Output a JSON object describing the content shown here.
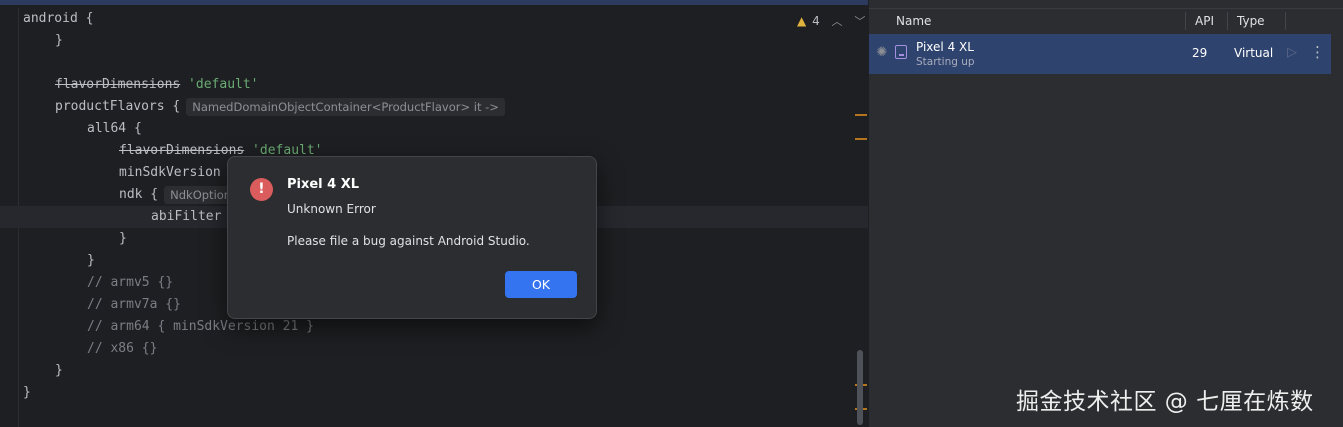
{
  "editor": {
    "lines": [
      {
        "indent": 0,
        "segments": [
          {
            "text": "android {",
            "cls": "kw"
          }
        ]
      },
      {
        "indent": 1,
        "segments": [
          {
            "text": "}",
            "cls": "kw"
          }
        ]
      },
      {
        "indent": 0,
        "segments": []
      },
      {
        "indent": 1,
        "segments": [
          {
            "text": "flavorDimensions",
            "cls": "kw strike"
          },
          {
            "text": " 'default'",
            "cls": "str"
          }
        ]
      },
      {
        "indent": 1,
        "segments": [
          {
            "text": "productFlavors {",
            "cls": "kw"
          }
        ],
        "hint": "NamedDomainObjectContainer<ProductFlavor> it ->"
      },
      {
        "indent": 2,
        "segments": [
          {
            "text": "all64",
            "cls": "fnname"
          },
          {
            "text": " {",
            "cls": "kw"
          }
        ]
      },
      {
        "indent": 3,
        "segments": [
          {
            "text": "flavorDimensions",
            "cls": "kw strike"
          },
          {
            "text": " 'default'",
            "cls": "str"
          }
        ]
      },
      {
        "indent": 3,
        "segments": [
          {
            "text": "minSdkVersion",
            "cls": "kw"
          }
        ]
      },
      {
        "indent": 3,
        "segments": [
          {
            "text": "ndk {",
            "cls": "kw"
          }
        ],
        "hint": "NdkOptions"
      },
      {
        "indent": 4,
        "segments": [
          {
            "text": "abiFilter",
            "cls": "kw"
          }
        ]
      },
      {
        "indent": 3,
        "segments": [
          {
            "text": "}",
            "cls": "kw"
          }
        ]
      },
      {
        "indent": 2,
        "segments": [
          {
            "text": "}",
            "cls": "kw"
          }
        ]
      },
      {
        "indent": 2,
        "segments": [
          {
            "text": "// armv5 {}",
            "cls": "cmt"
          }
        ]
      },
      {
        "indent": 2,
        "segments": [
          {
            "text": "// armv7a {}",
            "cls": "cmt"
          }
        ]
      },
      {
        "indent": 2,
        "segments": [
          {
            "text": "// arm64 { minSdkVersion 21 }",
            "cls": "cmt"
          }
        ]
      },
      {
        "indent": 2,
        "segments": [
          {
            "text": "// x86 {}",
            "cls": "cmt"
          }
        ]
      },
      {
        "indent": 1,
        "segments": [
          {
            "text": "}",
            "cls": "kw"
          }
        ]
      },
      {
        "indent": 0,
        "segments": [
          {
            "text": "}",
            "cls": "kw"
          }
        ]
      }
    ],
    "inspection_count": "4"
  },
  "device_manager": {
    "columns": {
      "name": "Name",
      "api": "API",
      "type": "Type"
    },
    "devices": [
      {
        "name": "Pixel 4 XL",
        "status": "Starting up",
        "api": "29",
        "type": "Virtual"
      }
    ]
  },
  "dialog": {
    "title": "Pixel 4 XL",
    "message": "Unknown Error",
    "detail": "Please file a bug against Android Studio.",
    "ok_label": "OK"
  },
  "watermark": "掘金技术社区 @ 七厘在炼数",
  "colors": {
    "accent": "#3574f0",
    "error": "#db5c5c",
    "selection": "#2e436e",
    "string": "#6aab73"
  }
}
